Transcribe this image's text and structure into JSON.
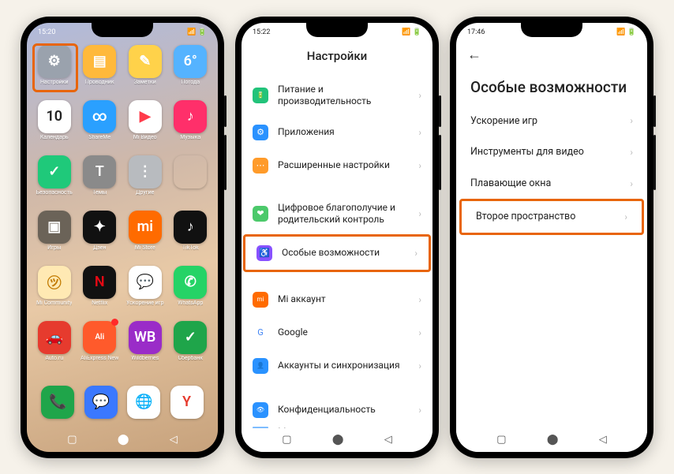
{
  "phone1": {
    "time": "15:20",
    "apps": [
      {
        "label": "Настройки",
        "bg": "#9aa2ad",
        "glyph": "⚙"
      },
      {
        "label": "Проводник",
        "bg": "#ffb93b",
        "glyph": "▤"
      },
      {
        "label": "Заметки",
        "bg": "#ffd24a",
        "glyph": "✎"
      },
      {
        "label": "Погода",
        "bg": "#55b3ff",
        "glyph": "6°"
      },
      {
        "label": "Календарь",
        "bg": "#ffffff",
        "glyph": "10",
        "fg": "#222"
      },
      {
        "label": "ShareMe",
        "bg": "#2aa0ff",
        "glyph": "∞"
      },
      {
        "label": "Mi Видео",
        "bg": "#ffffff",
        "glyph": "▶",
        "fg": "#ff3b4b"
      },
      {
        "label": "Музыка",
        "bg": "#ff2f6a",
        "glyph": "♪"
      },
      {
        "label": "Безопасность",
        "bg": "#1fc97a",
        "glyph": "✓"
      },
      {
        "label": "Темы",
        "bg": "#8a8a8a",
        "glyph": "T"
      },
      {
        "label": "Другие",
        "bg": "#b8bbbf",
        "glyph": "⋮"
      },
      {
        "label": "",
        "bg": "transparent",
        "glyph": ""
      },
      {
        "label": "Игры",
        "bg": "#6b6358",
        "glyph": "▣"
      },
      {
        "label": "Дзен",
        "bg": "#111",
        "glyph": "✦"
      },
      {
        "label": "Mi Store",
        "bg": "#ff6b00",
        "glyph": "mi"
      },
      {
        "label": "TikTok",
        "bg": "#111",
        "glyph": "♪"
      },
      {
        "label": "Mi Community",
        "bg": "#ffe9b3",
        "glyph": "㋡",
        "fg": "#c27a00"
      },
      {
        "label": "Netflix",
        "bg": "#111",
        "glyph": "N",
        "fg": "#e50914"
      },
      {
        "label": "Ускорение игр",
        "bg": "#fff",
        "glyph": "💬",
        "fg": "#2aa0ff"
      },
      {
        "label": "WhatsApp",
        "bg": "#25d366",
        "glyph": "✆"
      },
      {
        "label": "Auto.ru",
        "bg": "#e63b2e",
        "glyph": "🚗"
      },
      {
        "label": "AliExpress New",
        "bg": "#ff5a2b",
        "glyph": "Ali",
        "badge": true
      },
      {
        "label": "Wildberries",
        "bg": "#9a2cc8",
        "glyph": "WB"
      },
      {
        "label": "Сбербанк",
        "bg": "#1fa54a",
        "glyph": "✓"
      }
    ],
    "dock": [
      {
        "label": "",
        "bg": "#1fa54a",
        "glyph": "📞"
      },
      {
        "label": "",
        "bg": "#3a78ff",
        "glyph": "💬"
      },
      {
        "label": "",
        "bg": "#fff",
        "glyph": "🌐",
        "fg": "#3a78ff"
      },
      {
        "label": "",
        "bg": "#fff",
        "glyph": "Y",
        "fg": "#e63b2e"
      }
    ]
  },
  "phone2": {
    "time": "15:22",
    "title": "Настройки",
    "rows": [
      {
        "icon_bg": "#22c37a",
        "glyph": "🔋",
        "label": "Питание и производительность"
      },
      {
        "icon_bg": "#2a92ff",
        "glyph": "⚙",
        "label": "Приложения"
      },
      {
        "icon_bg": "#ff9b2a",
        "glyph": "⋯",
        "label": "Расширенные настройки"
      },
      {
        "gap": true
      },
      {
        "icon_bg": "#4cc96b",
        "glyph": "❤",
        "label": "Цифровое благополучие и родительский контроль"
      },
      {
        "icon_bg": "#8851ff",
        "glyph": "♿",
        "label": "Особые возможности",
        "highlight": true
      },
      {
        "gap": true
      },
      {
        "icon_bg": "#ff6b00",
        "glyph": "mi",
        "label": "Mi аккаунт"
      },
      {
        "icon_bg": "#fff",
        "glyph": "G",
        "label": "Google",
        "fg": "#4285f4"
      },
      {
        "icon_bg": "#2a92ff",
        "glyph": "👤",
        "label": "Аккаунты и синхронизация"
      },
      {
        "gap": true
      },
      {
        "icon_bg": "#2a92ff",
        "glyph": "👁",
        "label": "Конфиденциальность"
      },
      {
        "icon_bg": "#2a92ff",
        "glyph": "📍",
        "label": "Местоположение",
        "cut": true
      }
    ]
  },
  "phone3": {
    "time": "17:46",
    "title": "Особые возможности",
    "rows": [
      {
        "label": "Ускорение игр"
      },
      {
        "label": "Инструменты для видео"
      },
      {
        "label": "Плавающие окна"
      },
      {
        "label": "Второе пространство",
        "highlight": true
      }
    ]
  }
}
